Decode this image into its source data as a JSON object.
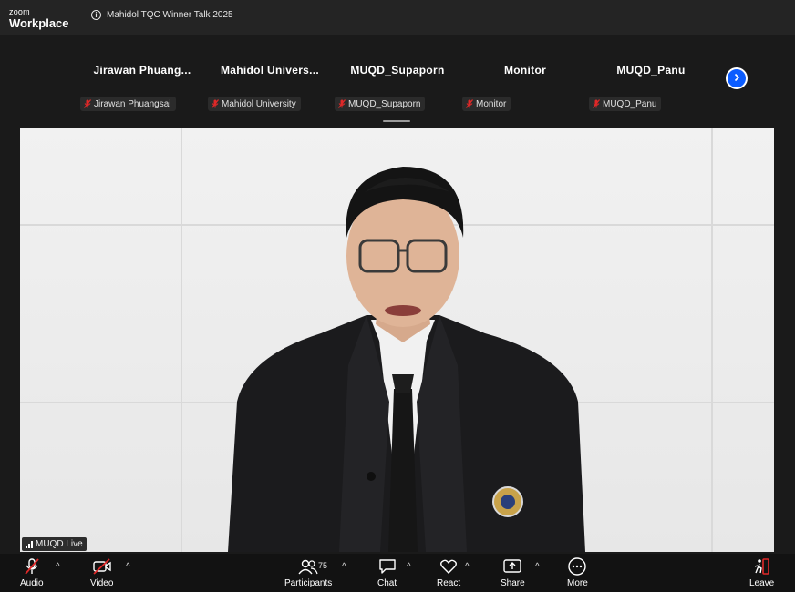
{
  "app": {
    "logo_small": "zoom",
    "logo_big": "Workplace"
  },
  "meeting": {
    "title": "Mahidol TQC Winner Talk 2025"
  },
  "participants_strip": [
    {
      "name": "Jirawan  Phuang...",
      "tag": "Jirawan Phuangsai"
    },
    {
      "name": "Mahidol  Univers...",
      "tag": "Mahidol University"
    },
    {
      "name": "MUQD_Supaporn",
      "tag": "MUQD_Supaporn"
    },
    {
      "name": "Monitor",
      "tag": "Monitor"
    },
    {
      "name": "MUQD_Panu",
      "tag": "MUQD_Panu"
    }
  ],
  "active_speaker": {
    "tag": "MUQD Live"
  },
  "toolbar": {
    "audio": "Audio",
    "video": "Video",
    "participants": "Participants",
    "participants_count": "75",
    "chat": "Chat",
    "react": "React",
    "share": "Share",
    "more": "More",
    "leave": "Leave"
  },
  "colors": {
    "accent": "#0b5cff",
    "muted": "#e02828",
    "bg": "#1a1a1a"
  }
}
